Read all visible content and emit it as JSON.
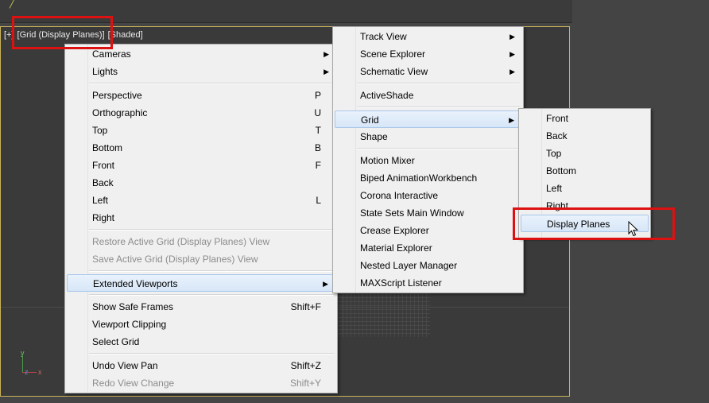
{
  "viewport": {
    "label_parts": [
      "[+]",
      "[Grid (Display Planes)]",
      "[Shaded]"
    ]
  },
  "main_menu": {
    "items": [
      {
        "label": "Cameras",
        "shortcut": "",
        "arrow": true
      },
      {
        "label": "Lights",
        "shortcut": "",
        "arrow": true
      },
      {
        "label": "Perspective",
        "shortcut": "P"
      },
      {
        "label": "Orthographic",
        "shortcut": "U"
      },
      {
        "label": "Top",
        "shortcut": "T"
      },
      {
        "label": "Bottom",
        "shortcut": "B"
      },
      {
        "label": "Front",
        "shortcut": "F"
      },
      {
        "label": "Back",
        "shortcut": ""
      },
      {
        "label": "Left",
        "shortcut": "L"
      },
      {
        "label": "Right",
        "shortcut": ""
      },
      {
        "label": "Restore Active Grid (Display Planes) View",
        "shortcut": ""
      },
      {
        "label": "Save Active Grid (Display Planes) View",
        "shortcut": ""
      },
      {
        "label": "Extended Viewports",
        "shortcut": "",
        "arrow": true
      },
      {
        "label": "Show Safe Frames",
        "shortcut": "Shift+F"
      },
      {
        "label": "Viewport Clipping",
        "shortcut": ""
      },
      {
        "label": "Select Grid",
        "shortcut": ""
      },
      {
        "label": "Undo View Pan",
        "shortcut": "Shift+Z"
      },
      {
        "label": "Redo View Change",
        "shortcut": "Shift+Y"
      }
    ]
  },
  "ext_menu": {
    "items": [
      {
        "label": "Track View",
        "arrow": true
      },
      {
        "label": "Scene Explorer",
        "arrow": true
      },
      {
        "label": "Schematic View",
        "arrow": true
      },
      {
        "label": "ActiveShade"
      },
      {
        "label": "Grid",
        "arrow": true
      },
      {
        "label": "Shape"
      },
      {
        "label": "Motion Mixer"
      },
      {
        "label": "Biped AnimationWorkbench"
      },
      {
        "label": "Corona Interactive"
      },
      {
        "label": "State Sets Main Window"
      },
      {
        "label": "Crease Explorer"
      },
      {
        "label": "Material Explorer"
      },
      {
        "label": "Nested Layer Manager"
      },
      {
        "label": "MAXScript Listener"
      }
    ]
  },
  "grid_menu": {
    "items": [
      {
        "label": "Front"
      },
      {
        "label": "Back"
      },
      {
        "label": "Top"
      },
      {
        "label": "Bottom"
      },
      {
        "label": "Left"
      },
      {
        "label": "Right"
      },
      {
        "label": "Display Planes"
      }
    ]
  },
  "axis": {
    "y": "y",
    "z": "z",
    "x": "x"
  },
  "colors": {
    "highlight_box": "#d11111",
    "viewport_border": "#c8b35a"
  }
}
